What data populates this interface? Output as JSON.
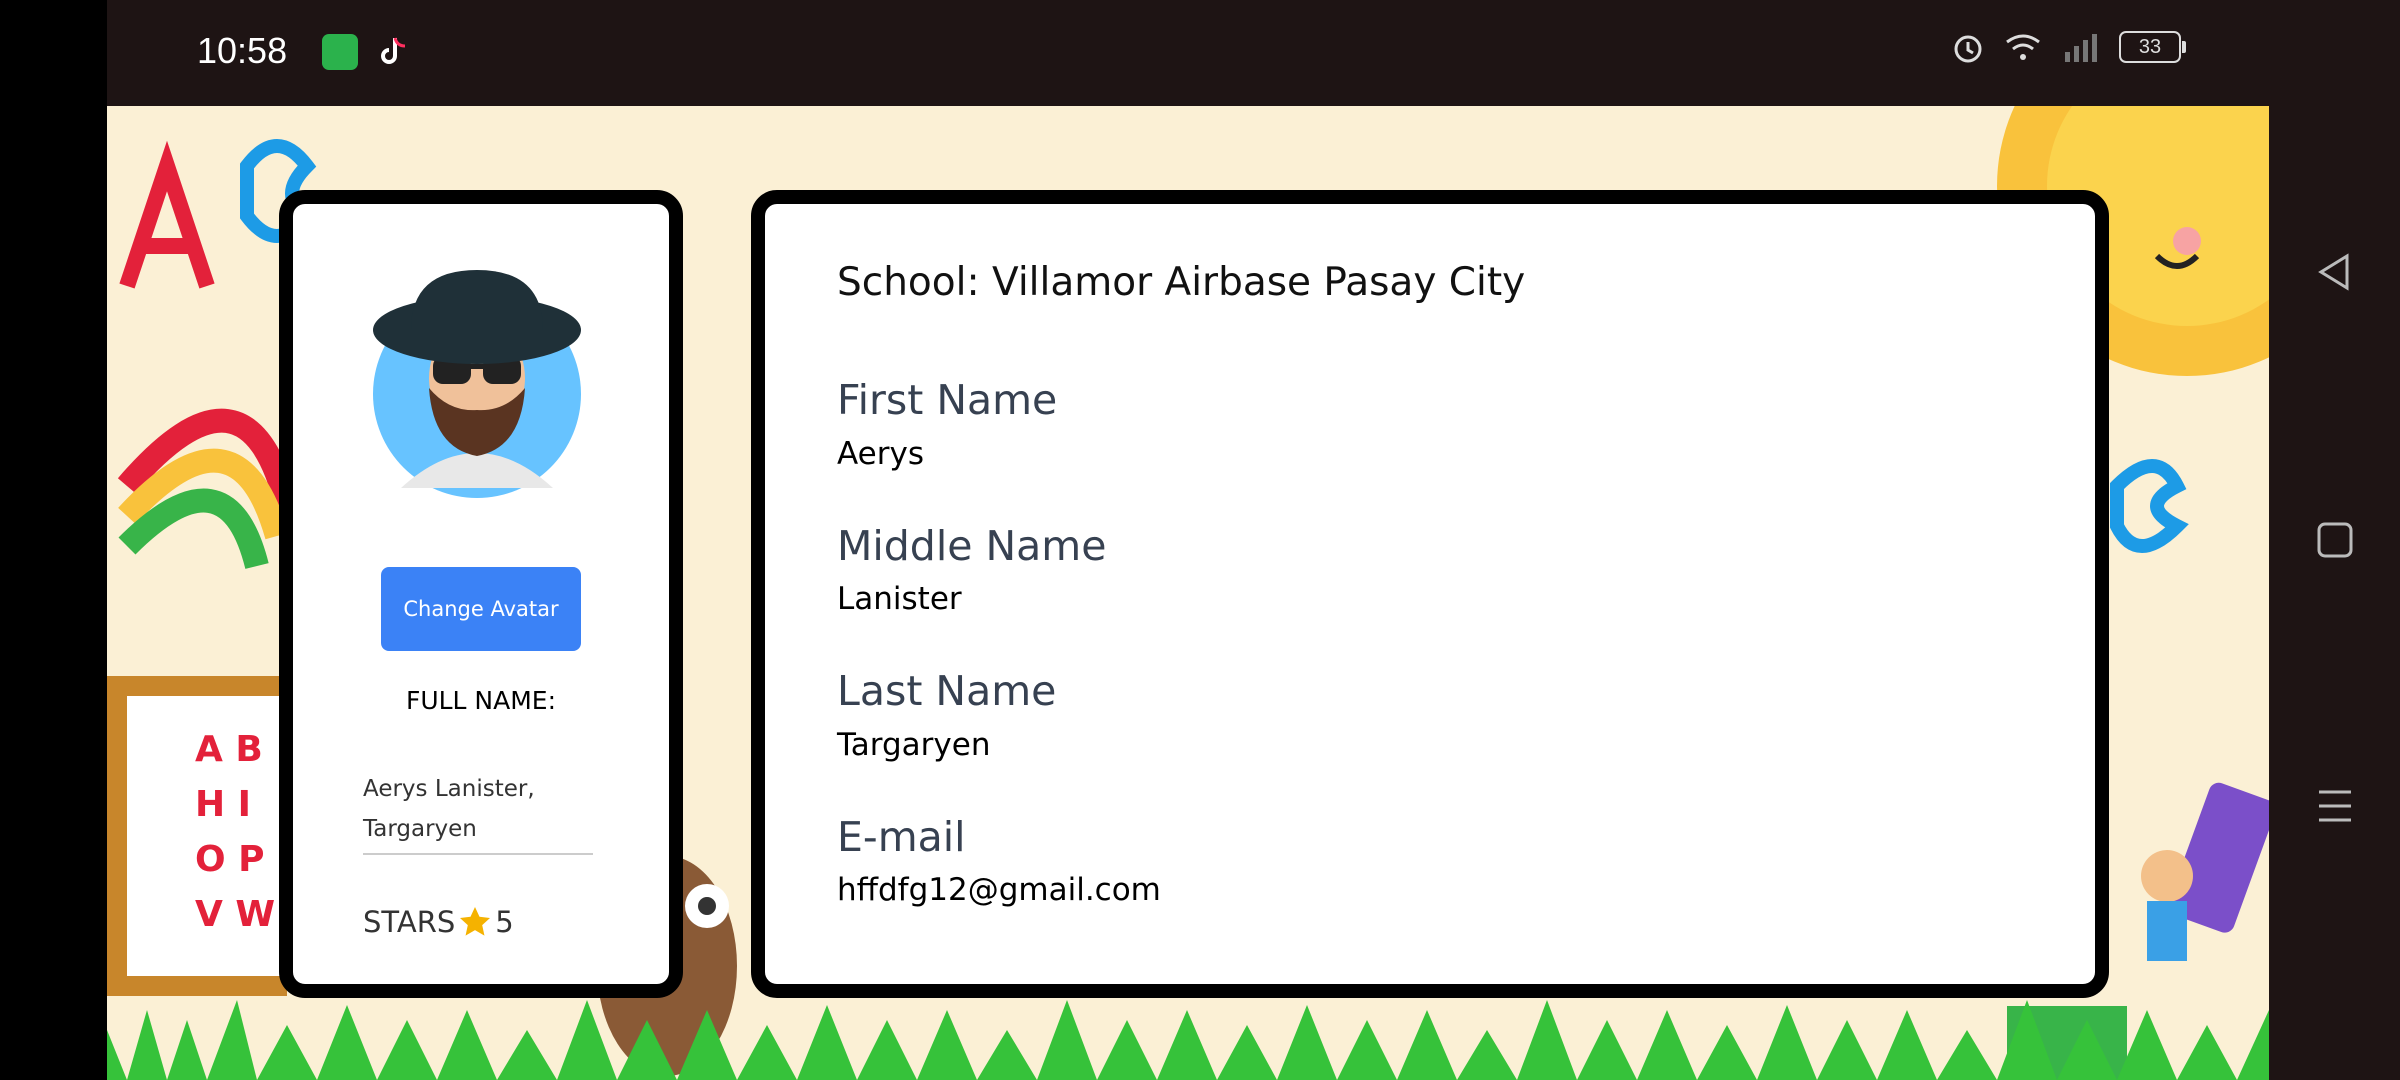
{
  "status_bar": {
    "time": "10:58",
    "battery": "33",
    "icons": [
      "alarm-icon",
      "wifi-icon",
      "signal-icon",
      "battery-icon"
    ]
  },
  "profile": {
    "change_avatar_label": "Change Avatar",
    "full_name_label": "FULL NAME:",
    "full_name_value": "Aerys Lanister, Targaryen",
    "stars_label": "STARS",
    "stars_count": "5",
    "accent": "#3b82f6",
    "star_color": "#f5b200"
  },
  "details": {
    "school": "School: Villamor Airbase Pasay City",
    "fields": [
      {
        "label": "First Name",
        "value": "Aerys"
      },
      {
        "label": "Middle Name",
        "value": "Lanister"
      },
      {
        "label": "Last Name",
        "value": "Targaryen"
      },
      {
        "label": "E-mail",
        "value": "hffdfg12@gmail.com"
      }
    ]
  }
}
